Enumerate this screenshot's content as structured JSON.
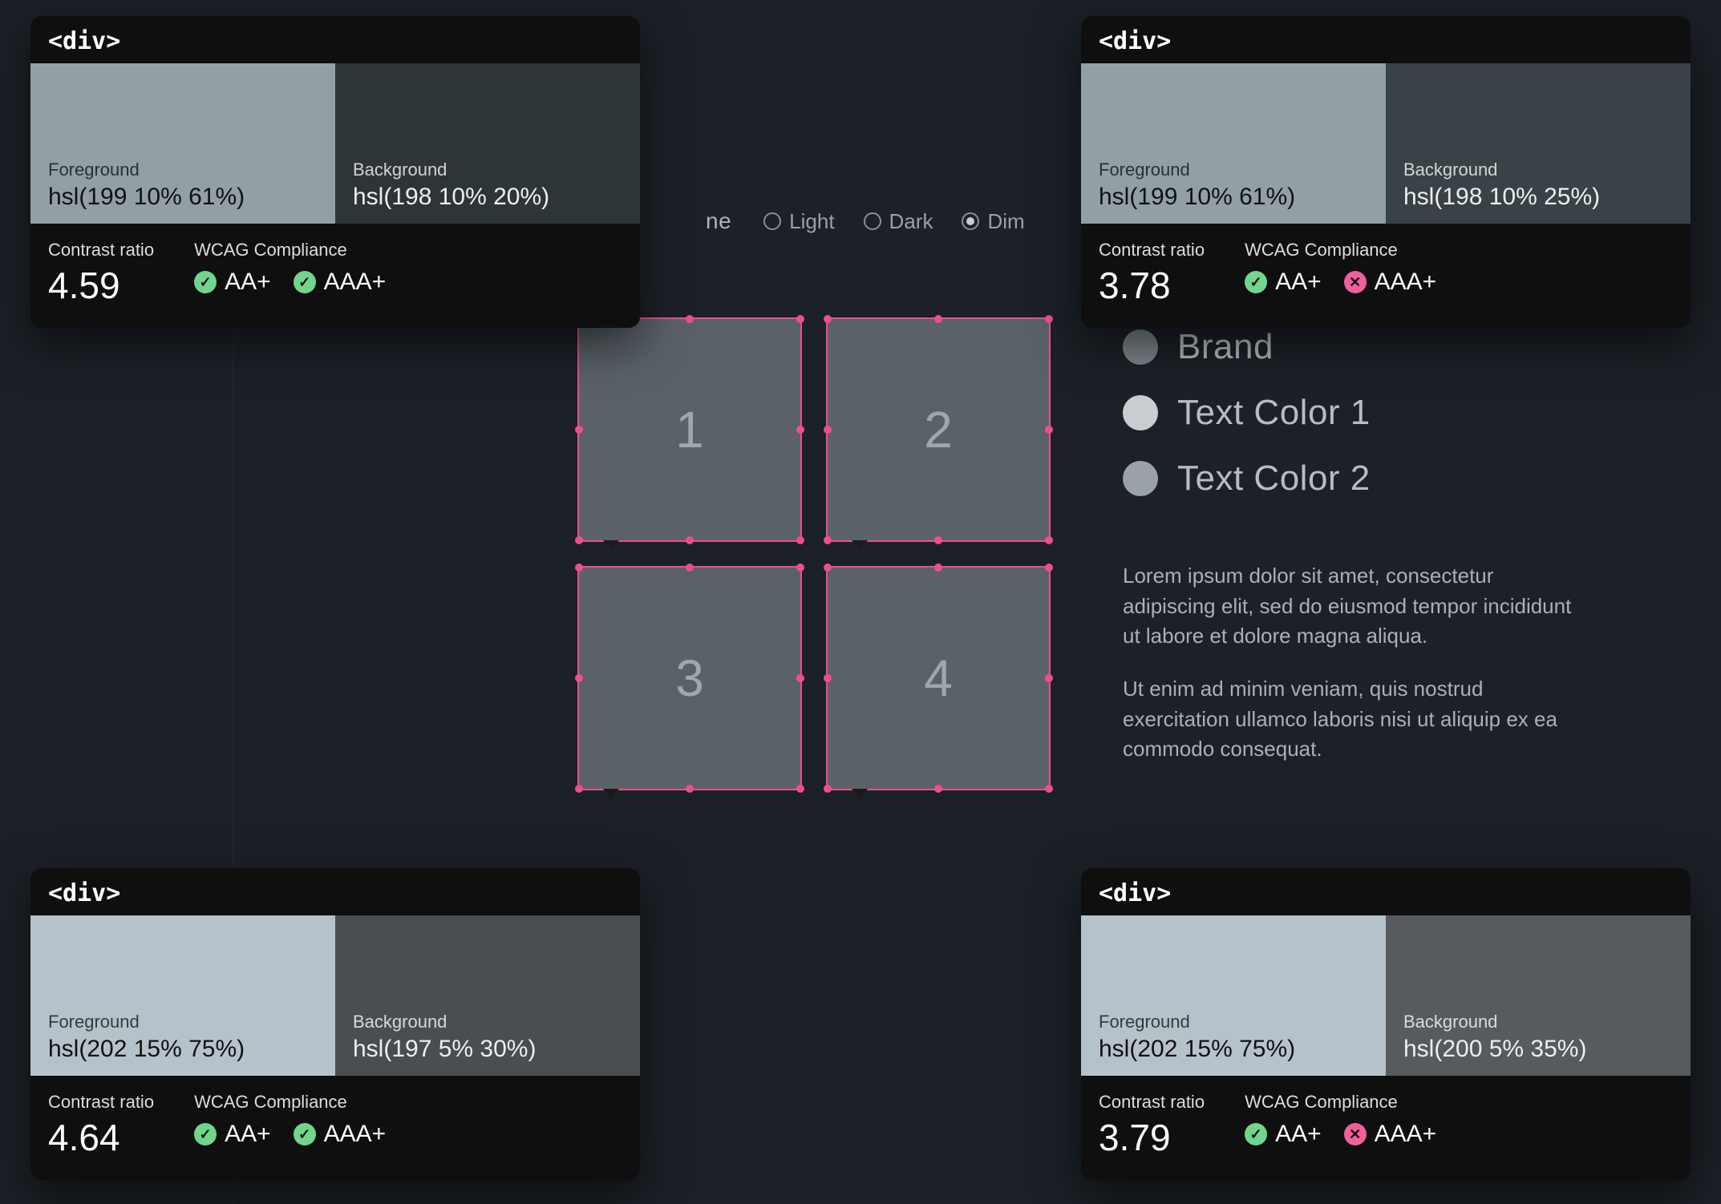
{
  "scheme": {
    "label_suffix": "ne",
    "options": [
      {
        "label": "Light",
        "selected": false
      },
      {
        "label": "Dark",
        "selected": false
      },
      {
        "label": "Dim",
        "selected": true
      }
    ]
  },
  "grid": {
    "cells": [
      "1",
      "2",
      "3",
      "4"
    ]
  },
  "legend": {
    "items": [
      {
        "label": "Brand",
        "color": "#7d868b"
      },
      {
        "label": "Text Color 1",
        "color": "#c9ced2"
      },
      {
        "label": "Text Color 2",
        "color": "#99a2a6"
      }
    ]
  },
  "paragraphs": [
    "Lorem ipsum dolor sit amet, consectetur adipiscing elit, sed do eiusmod tempor incididunt ut labore et dolore magna aliqua.",
    "Ut enim ad minim veniam, quis nostrud exercitation ullamco laboris nisi ut aliquip ex ea commodo consequat."
  ],
  "labels": {
    "element_tag": "<div>",
    "foreground": "Foreground",
    "background": "Background",
    "contrast_ratio": "Contrast ratio",
    "wcag": "WCAG Compliance",
    "aa": "AA+",
    "aaa": "AAA+"
  },
  "tooltips": [
    {
      "fg_value": "hsl(199 10% 61%)",
      "fg_css": "hsl(199,10%,61%)",
      "bg_value": "hsl(198 10% 20%)",
      "bg_css": "hsl(198,10%,20%)",
      "bg_is_dark": true,
      "ratio": "4.59",
      "aa_pass": true,
      "aaa_pass": true
    },
    {
      "fg_value": "hsl(199 10% 61%)",
      "fg_css": "hsl(199,10%,61%)",
      "bg_value": "hsl(198 10% 25%)",
      "bg_css": "hsl(198,10%,25%)",
      "bg_is_dark": true,
      "ratio": "3.78",
      "aa_pass": true,
      "aaa_pass": false
    },
    {
      "fg_value": "hsl(202 15% 75%)",
      "fg_css": "hsl(202,15%,75%)",
      "bg_value": "hsl(197 5% 30%)",
      "bg_css": "hsl(197,5%,30%)",
      "bg_is_dark": true,
      "ratio": "4.64",
      "aa_pass": true,
      "aaa_pass": true
    },
    {
      "fg_value": "hsl(202 15% 75%)",
      "fg_css": "hsl(202,15%,75%)",
      "bg_value": "hsl(200 5% 35%)",
      "bg_css": "hsl(200,5%,35%)",
      "bg_is_dark": true,
      "ratio": "3.79",
      "aa_pass": true,
      "aaa_pass": false
    }
  ]
}
